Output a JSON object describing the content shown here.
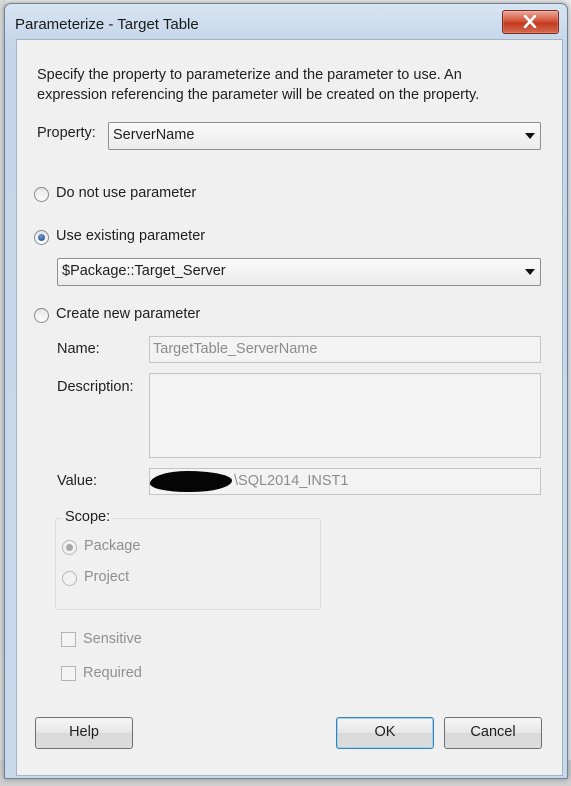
{
  "window": {
    "title": "Parameterize - Target Table"
  },
  "dialog": {
    "intro_line1": "Specify the property to parameterize and the parameter to use. An",
    "intro_line2": "expression referencing the parameter will be created on the property.",
    "property_label": "Property:",
    "property_value": "ServerName",
    "option_no_param": "Do not use parameter",
    "option_existing": "Use existing parameter",
    "existing_value": "$Package::Target_Server",
    "option_new": "Create new parameter",
    "name_label": "Name:",
    "name_value": "TargetTable_ServerName",
    "description_label": "Description:",
    "description_value": "",
    "value_label": "Value:",
    "value_suffix": "\\SQL2014_INST1",
    "scope_label": "Scope:",
    "scope_package": "Package",
    "scope_project": "Project",
    "sensitive_label": "Sensitive",
    "required_label": "Required",
    "selected_option": "Use existing parameter",
    "selected_scope": "Package"
  },
  "buttons": {
    "help": "Help",
    "ok": "OK",
    "cancel": "Cancel"
  },
  "icons": {
    "close": "close-icon",
    "dropdown": "chevron-down-icon"
  },
  "colors": {
    "titlebar": "#c9d9ec",
    "close_button": "#c33a1f",
    "client_bg": "#f0f0f0",
    "disabled_text": "#8f8f8f"
  }
}
